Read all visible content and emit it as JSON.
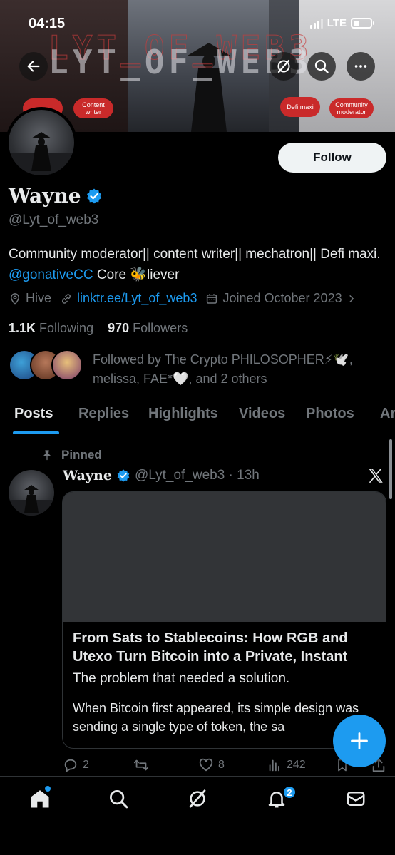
{
  "status_bar": {
    "time": "04:15",
    "network": "LTE"
  },
  "banner": {
    "title": "LYT_OF_WEB3",
    "pills": [
      "Content writer",
      "Defi maxi",
      "Community moderator"
    ]
  },
  "profile": {
    "name": "Wayne",
    "handle": "@Lyt_of_web3",
    "follow_label": "Follow",
    "bio_part1": "Community moderator|| content writer|| mechatron|| Defi maxi. ",
    "bio_mention": "@gonativeCC",
    "bio_part2": " Core ",
    "bio_emoji": "🐝",
    "bio_part3": "liever",
    "location": "Hive",
    "link": "linktr.ee/Lyt_of_web3",
    "joined": "Joined October 2023",
    "following_count": "1.1K",
    "following_label": "Following",
    "followers_count": "970",
    "followers_label": "Followers",
    "followed_by": "Followed by The Crypto PHILOSOPHER⚡🕊️, melissa, FAE*🤍, and 2 others"
  },
  "tabs": [
    "Posts",
    "Replies",
    "Highlights",
    "Videos",
    "Photos",
    "Ar"
  ],
  "post": {
    "pinned_label": "Pinned",
    "author": "Wayne",
    "meta": "@Lyt_of_web3 · 13h",
    "card_title": "From Sats to Stablecoins: How RGB and Utexo Turn Bitcoin into a Private, Instant",
    "card_subtitle": "The problem that needed a solution.",
    "card_body": "When Bitcoin first appeared, its simple design was sending a single type of token, the sa",
    "replies": "2",
    "likes": "8",
    "views": "242"
  },
  "nav": {
    "notifications_badge": "2"
  },
  "colors": {
    "accent": "#1d9bf0",
    "background": "#000000",
    "muted": "#71767b",
    "pill": "#c92a2a"
  }
}
